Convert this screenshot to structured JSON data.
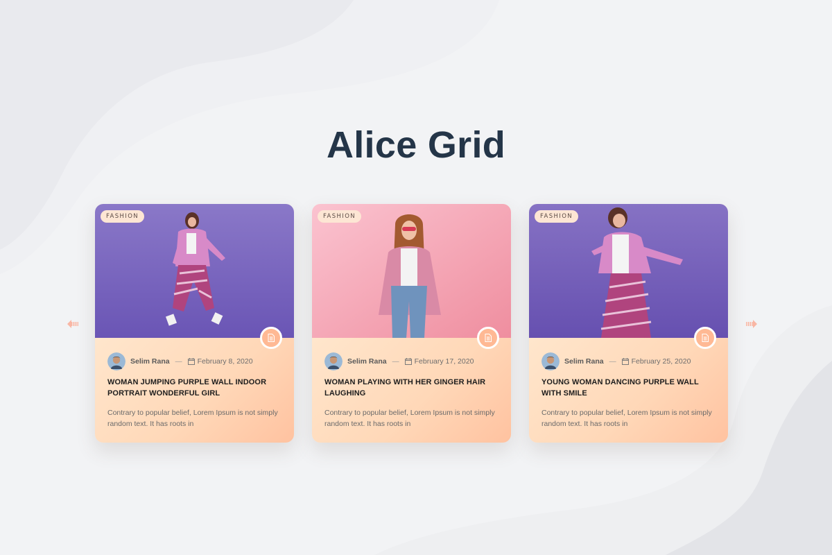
{
  "page": {
    "title": "Alice Grid"
  },
  "nav": {
    "prev_icon": "arrow-left-icon",
    "next_icon": "arrow-right-icon"
  },
  "colors": {
    "title": "#243548",
    "accent": "#ffb994",
    "card_gradient_start": "#fff1dc",
    "card_gradient_end": "#ffc2a0",
    "background": "#f2f3f5"
  },
  "cards": [
    {
      "tag": "FASHION",
      "author": "Selim Rana",
      "separator": "—",
      "date": "February 8, 2020",
      "title": "WOMAN JUMPING PURPLE WALL INDOOR PORTRAIT WONDERFUL GIRL",
      "excerpt": "Contrary to popular belief, Lorem Ipsum is not simply random text. It has roots in"
    },
    {
      "tag": "FASHION",
      "author": "Selim Rana",
      "separator": "—",
      "date": "February 17, 2020",
      "title": "WOMAN PLAYING WITH HER GINGER HAIR LAUGHING",
      "excerpt": "Contrary to popular belief, Lorem Ipsum is not simply random text. It has roots in"
    },
    {
      "tag": "FASHION",
      "author": "Selim Rana",
      "separator": "—",
      "date": "February 25, 2020",
      "title": "YOUNG WOMAN DANCING PURPLE WALL WITH SMILE",
      "excerpt": "Contrary to popular belief, Lorem Ipsum is not simply random text. It has roots in"
    }
  ]
}
